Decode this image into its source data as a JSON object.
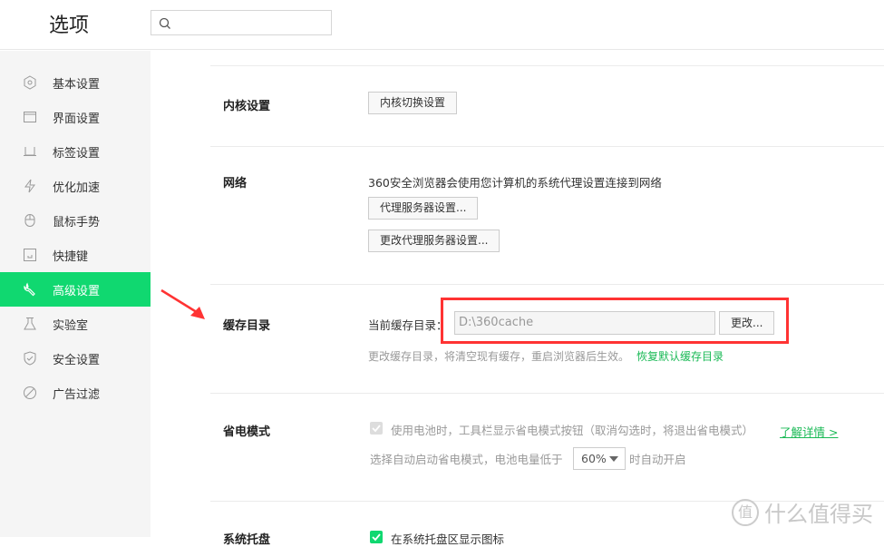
{
  "header": {
    "title": "选项",
    "search_placeholder": ""
  },
  "sidebar": {
    "items": [
      {
        "label": "基本设置",
        "icon": "gear-icon"
      },
      {
        "label": "界面设置",
        "icon": "window-icon"
      },
      {
        "label": "标签设置",
        "icon": "tab-icon"
      },
      {
        "label": "优化加速",
        "icon": "lightning-icon"
      },
      {
        "label": "鼠标手势",
        "icon": "mouse-icon"
      },
      {
        "label": "快捷键",
        "icon": "keyboard-icon"
      },
      {
        "label": "高级设置",
        "icon": "wrench-icon",
        "active": true
      },
      {
        "label": "实验室",
        "icon": "flask-icon"
      },
      {
        "label": "安全设置",
        "icon": "shield-icon"
      },
      {
        "label": "广告过滤",
        "icon": "block-icon"
      }
    ]
  },
  "kernel": {
    "label": "内核设置",
    "button": "内核切换设置"
  },
  "network": {
    "label": "网络",
    "desc": "360安全浏览器会使用您计算机的系统代理设置连接到网络",
    "proxy_button": "代理服务器设置...",
    "change_proxy_button": "更改代理服务器设置..."
  },
  "cache": {
    "label": "缓存目录",
    "current_label": "当前缓存目录：",
    "path": "D:\\360cache",
    "change_button": "更改...",
    "note": "更改缓存目录，将清空现有缓存，重启浏览器后生效。",
    "restore_link": "恢复默认缓存目录"
  },
  "power": {
    "label": "省电模式",
    "checkbox_label": "使用电池时，工具栏显示省电模式按钮（取消勾选时，将退出省电模式）",
    "checked": true,
    "disabled": true,
    "learn_more": "了解详情 >",
    "auto_prefix": "选择自动启动省电模式，电池电量低于",
    "threshold": "60%",
    "auto_suffix": "时自动开启"
  },
  "tray": {
    "label": "系统托盘",
    "checkbox_label": "在系统托盘区显示图标",
    "checked": true
  },
  "watermark": {
    "text": "什么值得买",
    "logo": "值"
  },
  "colors": {
    "accent": "#10d870",
    "highlight": "#ff3333",
    "link": "#19b955"
  }
}
